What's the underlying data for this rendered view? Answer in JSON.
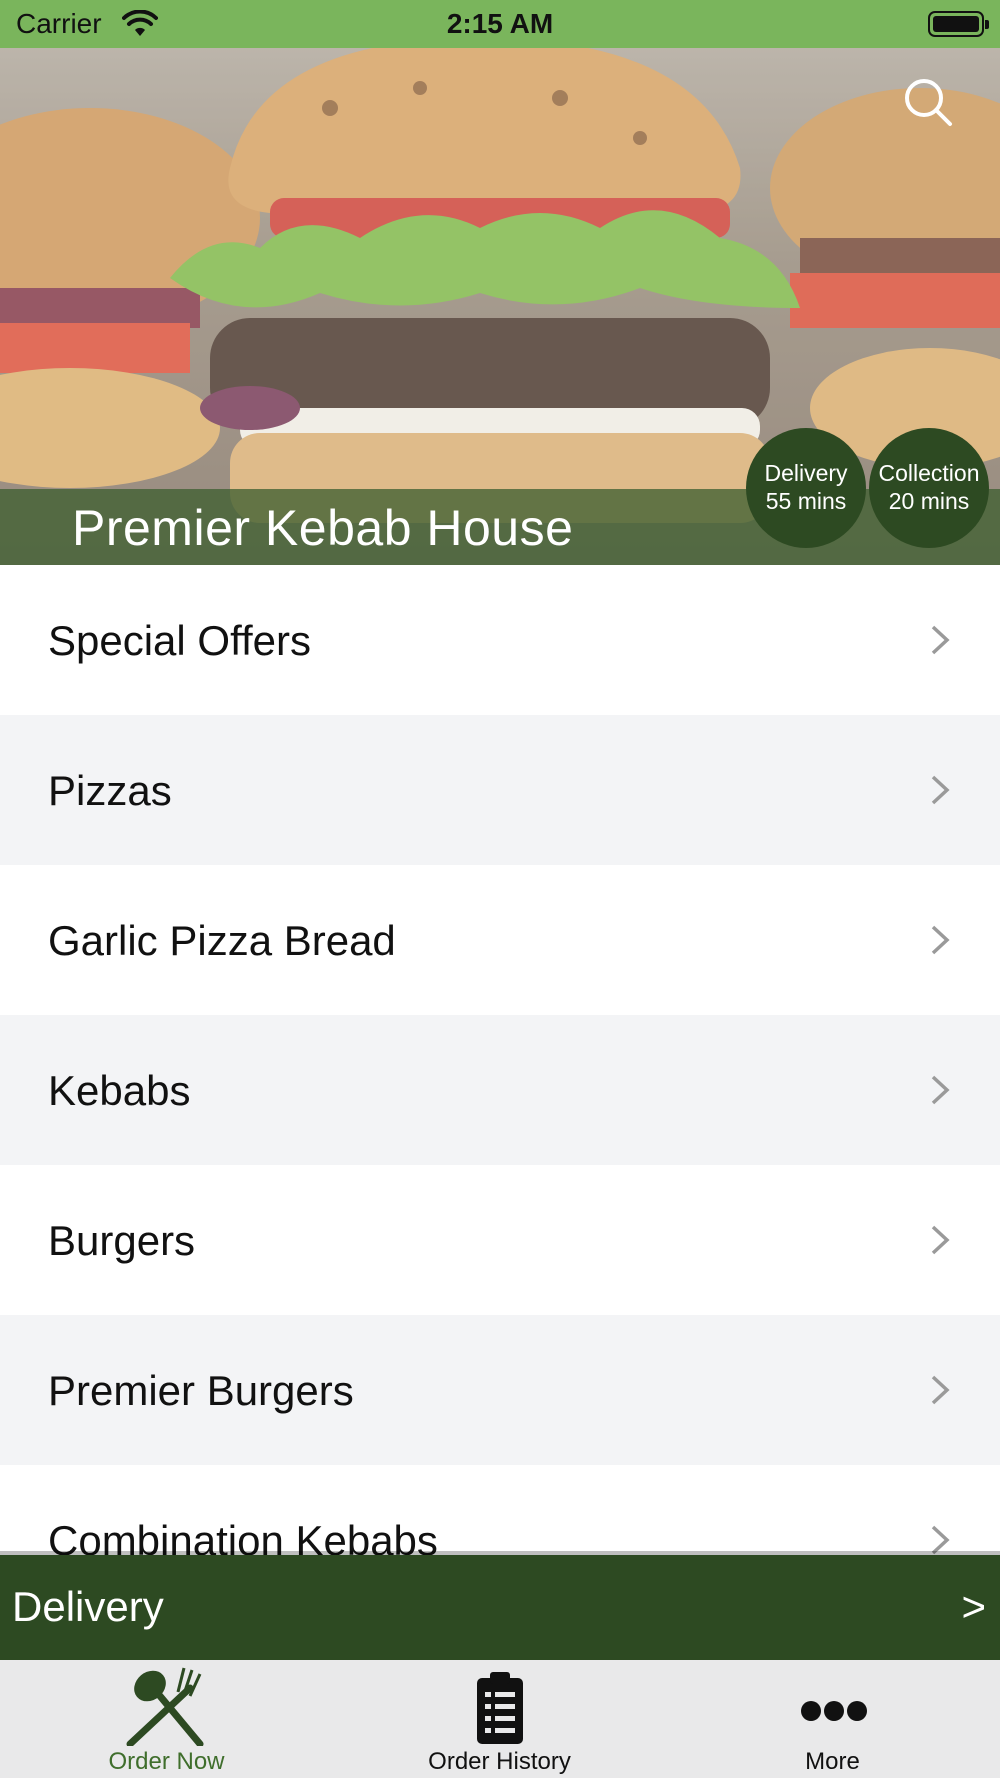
{
  "status_bar": {
    "carrier": "Carrier",
    "time": "2:15 AM"
  },
  "hero": {
    "restaurant_name": "Premier Kebab House",
    "delivery_badge": {
      "line1": "Delivery",
      "line2": "55 mins"
    },
    "collection_badge": {
      "line1": "Collection",
      "line2": "20 mins"
    },
    "search_icon": "search-icon"
  },
  "menu": {
    "items": [
      {
        "label": "Special Offers"
      },
      {
        "label": "Pizzas"
      },
      {
        "label": "Garlic Pizza Bread"
      },
      {
        "label": "Kebabs"
      },
      {
        "label": "Burgers"
      },
      {
        "label": "Premier Burgers"
      },
      {
        "label": "Combination Kebabs"
      }
    ]
  },
  "delivery_bar": {
    "label": "Delivery",
    "arrow": ">"
  },
  "tabs": [
    {
      "label": "Order Now",
      "icon": "fork-knife-icon",
      "active": true
    },
    {
      "label": "Order History",
      "icon": "clipboard-list-icon",
      "active": false
    },
    {
      "label": "More",
      "icon": "more-dots-icon",
      "active": false
    }
  ],
  "colors": {
    "status_bar": "#7ab55c",
    "brand_dark_green": "#2d4a22",
    "active_tab": "#3f6e2c",
    "tab_bar_bg": "#e9e9ea",
    "alt_row_bg": "#f3f4f6"
  }
}
